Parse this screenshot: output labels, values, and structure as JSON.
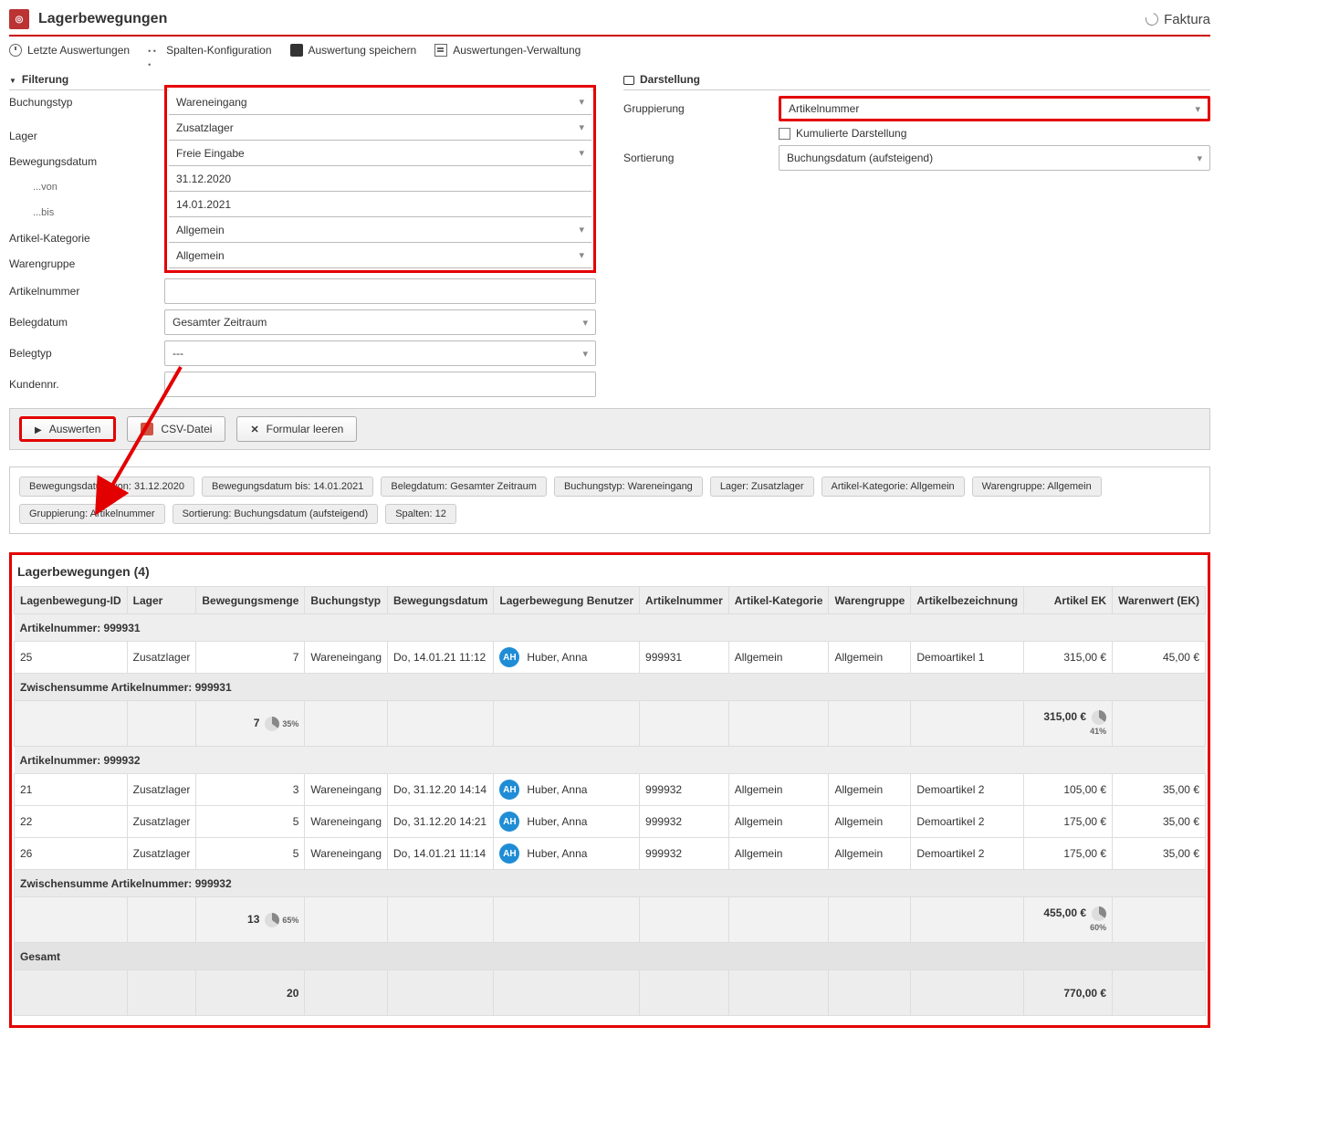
{
  "header": {
    "title": "Lagerbewegungen",
    "faktura": "Faktura"
  },
  "toolbar": {
    "recent": "Letzte Auswertungen",
    "columns": "Spalten-Konfiguration",
    "save": "Auswertung speichern",
    "manage": "Auswertungen-Verwaltung"
  },
  "sections": {
    "filter": "Filterung",
    "display": "Darstellung"
  },
  "filter": {
    "bookingType": {
      "label": "Buchungstyp",
      "value": "Wareneingang"
    },
    "warehouse": {
      "label": "Lager",
      "value": "Zusatzlager"
    },
    "moveDate": {
      "label": "Bewegungsdatum",
      "value": "Freie Eingabe"
    },
    "from": {
      "label": "...von",
      "value": "31.12.2020"
    },
    "to": {
      "label": "...bis",
      "value": "14.01.2021"
    },
    "category": {
      "label": "Artikel-Kategorie",
      "value": "Allgemein"
    },
    "productGroup": {
      "label": "Warengruppe",
      "value": "Allgemein"
    },
    "articleNo": {
      "label": "Artikelnummer",
      "value": ""
    },
    "docDate": {
      "label": "Belegdatum",
      "value": "Gesamter Zeitraum"
    },
    "docType": {
      "label": "Belegtyp",
      "value": "---"
    },
    "customerNo": {
      "label": "Kundennr.",
      "value": ""
    }
  },
  "display": {
    "grouping": {
      "label": "Gruppierung",
      "value": "Artikelnummer"
    },
    "cumulative": {
      "label": "Kumulierte Darstellung"
    },
    "sorting": {
      "label": "Sortierung",
      "value": "Buchungsdatum (aufsteigend)"
    }
  },
  "actions": {
    "evaluate": "Auswerten",
    "csv": "CSV-Datei",
    "clear": "Formular leeren"
  },
  "tags": [
    "Bewegungsdatum von: 31.12.2020",
    "Bewegungsdatum bis: 14.01.2021",
    "Belegdatum: Gesamter Zeitraum",
    "Buchungstyp: Wareneingang",
    "Lager: Zusatzlager",
    "Artikel-Kategorie: Allgemein",
    "Warengruppe: Allgemein",
    "Gruppierung: Artikelnummer",
    "Sortierung: Buchungsdatum (aufsteigend)",
    "Spalten: 12"
  ],
  "results": {
    "title": "Lagerbewegungen (4)",
    "columns": [
      "Lagenbewegung-ID",
      "Lager",
      "Bewegungsmenge",
      "Buchungstyp",
      "Bewegungsdatum",
      "Lagerbewegung Benutzer",
      "Artikelnummer",
      "Artikel-Kategorie",
      "Warengruppe",
      "Artikelbezeichnung",
      "Artikel EK",
      "Warenwert (EK)"
    ],
    "groups": [
      {
        "header": "Artikelnummer: 999931",
        "rows": [
          {
            "id": "25",
            "warehouse": "Zusatzlager",
            "qty": "7",
            "type": "Wareneingang",
            "date": "Do, 14.01.21 11:12",
            "userInitials": "AH",
            "user": "Huber, Anna",
            "article": "999931",
            "category": "Allgemein",
            "group": "Allgemein",
            "name": "Demoartikel 1",
            "ek": "315,00 €",
            "worth": "45,00 €"
          }
        ],
        "subtotalLabel": "Zwischensumme Artikelnummer: 999931",
        "subtotal": {
          "qty": "7",
          "qtyPct": "35%",
          "ek": "315,00 €",
          "ekPct": "41%"
        }
      },
      {
        "header": "Artikelnummer: 999932",
        "rows": [
          {
            "id": "21",
            "warehouse": "Zusatzlager",
            "qty": "3",
            "type": "Wareneingang",
            "date": "Do, 31.12.20 14:14",
            "userInitials": "AH",
            "user": "Huber, Anna",
            "article": "999932",
            "category": "Allgemein",
            "group": "Allgemein",
            "name": "Demoartikel 2",
            "ek": "105,00 €",
            "worth": "35,00 €"
          },
          {
            "id": "22",
            "warehouse": "Zusatzlager",
            "qty": "5",
            "type": "Wareneingang",
            "date": "Do, 31.12.20 14:21",
            "userInitials": "AH",
            "user": "Huber, Anna",
            "article": "999932",
            "category": "Allgemein",
            "group": "Allgemein",
            "name": "Demoartikel 2",
            "ek": "175,00 €",
            "worth": "35,00 €"
          },
          {
            "id": "26",
            "warehouse": "Zusatzlager",
            "qty": "5",
            "type": "Wareneingang",
            "date": "Do, 14.01.21 11:14",
            "userInitials": "AH",
            "user": "Huber, Anna",
            "article": "999932",
            "category": "Allgemein",
            "group": "Allgemein",
            "name": "Demoartikel 2",
            "ek": "175,00 €",
            "worth": "35,00 €"
          }
        ],
        "subtotalLabel": "Zwischensumme Artikelnummer: 999932",
        "subtotal": {
          "qty": "13",
          "qtyPct": "65%",
          "ek": "455,00 €",
          "ekPct": "60%"
        }
      }
    ],
    "grandLabel": "Gesamt",
    "grand": {
      "qty": "20",
      "ek": "770,00 €"
    }
  }
}
